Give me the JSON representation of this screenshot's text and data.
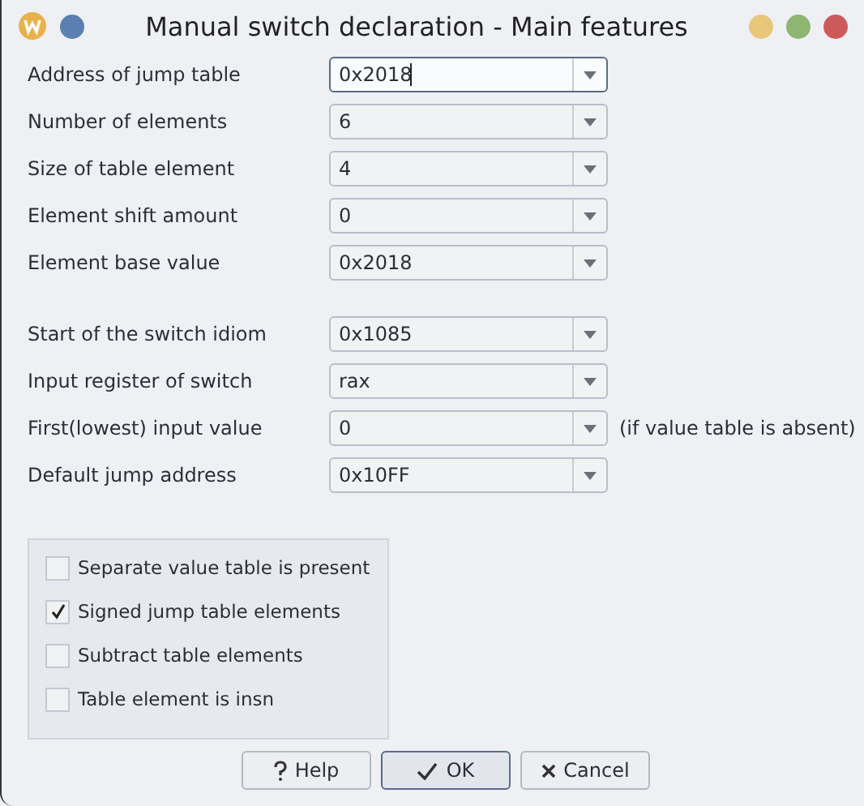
{
  "window": {
    "title": "Manual switch declaration - Main features"
  },
  "field_groups": [
    {
      "fields": [
        {
          "label": "Address of jump table",
          "value": "0x2018",
          "focused": true
        },
        {
          "label": "Number of elements",
          "value": "6",
          "focused": false
        },
        {
          "label": "Size of table element",
          "value": "4",
          "focused": false
        },
        {
          "label": "Element shift amount",
          "value": "0",
          "focused": false
        },
        {
          "label": "Element base value",
          "value": "0x2018",
          "focused": false
        }
      ]
    },
    {
      "fields": [
        {
          "label": "Start of the switch idiom",
          "value": "0x1085",
          "focused": false
        },
        {
          "label": "Input register of switch",
          "value": "rax",
          "focused": false
        },
        {
          "label": "First(lowest) input value",
          "value": "0",
          "focused": false,
          "note": "(if value table is absent)"
        },
        {
          "label": "Default jump address",
          "value": "0x10FF",
          "focused": false
        }
      ]
    }
  ],
  "options": [
    {
      "label": "Separate value table is present",
      "checked": false
    },
    {
      "label": "Signed jump table elements",
      "checked": true
    },
    {
      "label": "Subtract table elements",
      "checked": false
    },
    {
      "label": "Table element is insn",
      "checked": false
    }
  ],
  "buttons": [
    {
      "kind": "help",
      "label": "Help",
      "default": false
    },
    {
      "kind": "ok",
      "label": "OK",
      "default": true
    },
    {
      "kind": "cancel",
      "label": "Cancel",
      "default": false
    }
  ]
}
